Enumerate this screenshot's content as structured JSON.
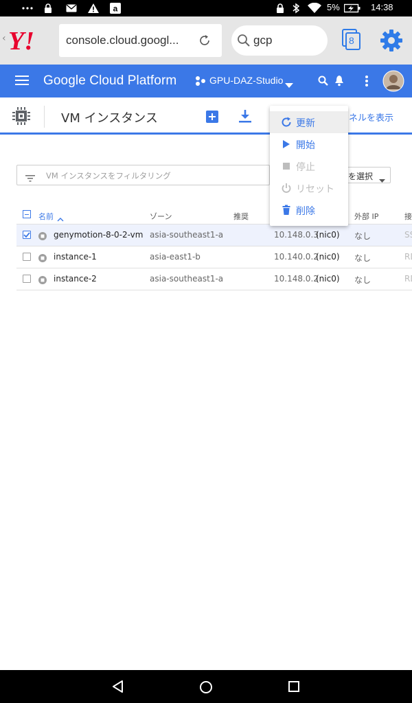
{
  "status_bar": {
    "battery": "5%",
    "time": "14:38"
  },
  "browser": {
    "url": "console.cloud.googl...",
    "search_query": "gcp",
    "tabs_count": "8"
  },
  "gcp_header": {
    "title": "Google Cloud Platform",
    "project": "GPU-DAZ-Studio"
  },
  "toolbar": {
    "page_title": "VM インスタンス",
    "info_panel_label": "ネルを表示"
  },
  "filter": {
    "placeholder": "VM インスタンスをフィルタリング",
    "column_select_label": "を選択"
  },
  "table": {
    "headers": {
      "name": "名前",
      "zone": "ゾーン",
      "recommend": "推奨",
      "external_ip": "外部 IP",
      "connect": "接"
    },
    "rows": [
      {
        "name": "genymotion-8-0-2-vm",
        "zone": "asia-southeast1-a",
        "internal_ip": "10.148.0.3",
        "nic": "(nic0)",
        "external_ip": "なし",
        "connect": "SS",
        "selected": true
      },
      {
        "name": "instance-1",
        "zone": "asia-east1-b",
        "internal_ip": "10.140.0.2",
        "nic": "(nic0)",
        "external_ip": "なし",
        "connect": "RD",
        "selected": false
      },
      {
        "name": "instance-2",
        "zone": "asia-southeast1-a",
        "internal_ip": "10.148.0.2",
        "nic": "(nic0)",
        "external_ip": "なし",
        "connect": "RD",
        "selected": false
      }
    ]
  },
  "menu": {
    "items": [
      {
        "label": "更新",
        "icon": "refresh-icon",
        "enabled": true
      },
      {
        "label": "開始",
        "icon": "play-icon",
        "enabled": true
      },
      {
        "label": "停止",
        "icon": "stop-icon",
        "enabled": false
      },
      {
        "label": "リセット",
        "icon": "power-icon",
        "enabled": false
      },
      {
        "label": "削除",
        "icon": "trash-icon",
        "enabled": true
      }
    ]
  },
  "colors": {
    "gcp_blue": "#3b78e7",
    "browser_gear": "#2f7be8",
    "yahoo_red": "#e8002d",
    "disabled": "#bdbdbd"
  }
}
